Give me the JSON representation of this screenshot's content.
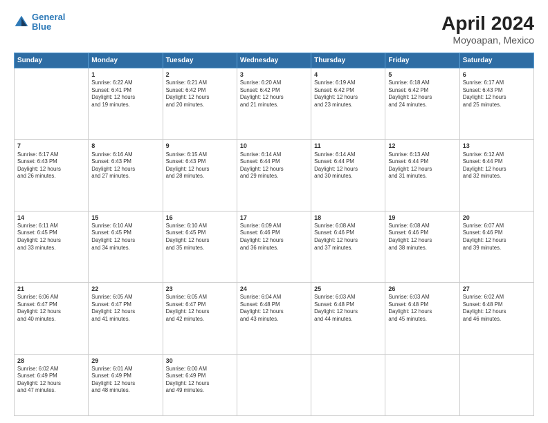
{
  "header": {
    "logo_line1": "General",
    "logo_line2": "Blue",
    "title": "April 2024",
    "subtitle": "Moyoapan, Mexico"
  },
  "days_of_week": [
    "Sunday",
    "Monday",
    "Tuesday",
    "Wednesday",
    "Thursday",
    "Friday",
    "Saturday"
  ],
  "weeks": [
    [
      {
        "num": "",
        "info": ""
      },
      {
        "num": "1",
        "info": "Sunrise: 6:22 AM\nSunset: 6:41 PM\nDaylight: 12 hours\nand 19 minutes."
      },
      {
        "num": "2",
        "info": "Sunrise: 6:21 AM\nSunset: 6:42 PM\nDaylight: 12 hours\nand 20 minutes."
      },
      {
        "num": "3",
        "info": "Sunrise: 6:20 AM\nSunset: 6:42 PM\nDaylight: 12 hours\nand 21 minutes."
      },
      {
        "num": "4",
        "info": "Sunrise: 6:19 AM\nSunset: 6:42 PM\nDaylight: 12 hours\nand 23 minutes."
      },
      {
        "num": "5",
        "info": "Sunrise: 6:18 AM\nSunset: 6:42 PM\nDaylight: 12 hours\nand 24 minutes."
      },
      {
        "num": "6",
        "info": "Sunrise: 6:17 AM\nSunset: 6:43 PM\nDaylight: 12 hours\nand 25 minutes."
      }
    ],
    [
      {
        "num": "7",
        "info": "Sunrise: 6:17 AM\nSunset: 6:43 PM\nDaylight: 12 hours\nand 26 minutes."
      },
      {
        "num": "8",
        "info": "Sunrise: 6:16 AM\nSunset: 6:43 PM\nDaylight: 12 hours\nand 27 minutes."
      },
      {
        "num": "9",
        "info": "Sunrise: 6:15 AM\nSunset: 6:43 PM\nDaylight: 12 hours\nand 28 minutes."
      },
      {
        "num": "10",
        "info": "Sunrise: 6:14 AM\nSunset: 6:44 PM\nDaylight: 12 hours\nand 29 minutes."
      },
      {
        "num": "11",
        "info": "Sunrise: 6:14 AM\nSunset: 6:44 PM\nDaylight: 12 hours\nand 30 minutes."
      },
      {
        "num": "12",
        "info": "Sunrise: 6:13 AM\nSunset: 6:44 PM\nDaylight: 12 hours\nand 31 minutes."
      },
      {
        "num": "13",
        "info": "Sunrise: 6:12 AM\nSunset: 6:44 PM\nDaylight: 12 hours\nand 32 minutes."
      }
    ],
    [
      {
        "num": "14",
        "info": "Sunrise: 6:11 AM\nSunset: 6:45 PM\nDaylight: 12 hours\nand 33 minutes."
      },
      {
        "num": "15",
        "info": "Sunrise: 6:10 AM\nSunset: 6:45 PM\nDaylight: 12 hours\nand 34 minutes."
      },
      {
        "num": "16",
        "info": "Sunrise: 6:10 AM\nSunset: 6:45 PM\nDaylight: 12 hours\nand 35 minutes."
      },
      {
        "num": "17",
        "info": "Sunrise: 6:09 AM\nSunset: 6:46 PM\nDaylight: 12 hours\nand 36 minutes."
      },
      {
        "num": "18",
        "info": "Sunrise: 6:08 AM\nSunset: 6:46 PM\nDaylight: 12 hours\nand 37 minutes."
      },
      {
        "num": "19",
        "info": "Sunrise: 6:08 AM\nSunset: 6:46 PM\nDaylight: 12 hours\nand 38 minutes."
      },
      {
        "num": "20",
        "info": "Sunrise: 6:07 AM\nSunset: 6:46 PM\nDaylight: 12 hours\nand 39 minutes."
      }
    ],
    [
      {
        "num": "21",
        "info": "Sunrise: 6:06 AM\nSunset: 6:47 PM\nDaylight: 12 hours\nand 40 minutes."
      },
      {
        "num": "22",
        "info": "Sunrise: 6:05 AM\nSunset: 6:47 PM\nDaylight: 12 hours\nand 41 minutes."
      },
      {
        "num": "23",
        "info": "Sunrise: 6:05 AM\nSunset: 6:47 PM\nDaylight: 12 hours\nand 42 minutes."
      },
      {
        "num": "24",
        "info": "Sunrise: 6:04 AM\nSunset: 6:48 PM\nDaylight: 12 hours\nand 43 minutes."
      },
      {
        "num": "25",
        "info": "Sunrise: 6:03 AM\nSunset: 6:48 PM\nDaylight: 12 hours\nand 44 minutes."
      },
      {
        "num": "26",
        "info": "Sunrise: 6:03 AM\nSunset: 6:48 PM\nDaylight: 12 hours\nand 45 minutes."
      },
      {
        "num": "27",
        "info": "Sunrise: 6:02 AM\nSunset: 6:48 PM\nDaylight: 12 hours\nand 46 minutes."
      }
    ],
    [
      {
        "num": "28",
        "info": "Sunrise: 6:02 AM\nSunset: 6:49 PM\nDaylight: 12 hours\nand 47 minutes."
      },
      {
        "num": "29",
        "info": "Sunrise: 6:01 AM\nSunset: 6:49 PM\nDaylight: 12 hours\nand 48 minutes."
      },
      {
        "num": "30",
        "info": "Sunrise: 6:00 AM\nSunset: 6:49 PM\nDaylight: 12 hours\nand 49 minutes."
      },
      {
        "num": "",
        "info": ""
      },
      {
        "num": "",
        "info": ""
      },
      {
        "num": "",
        "info": ""
      },
      {
        "num": "",
        "info": ""
      }
    ]
  ]
}
